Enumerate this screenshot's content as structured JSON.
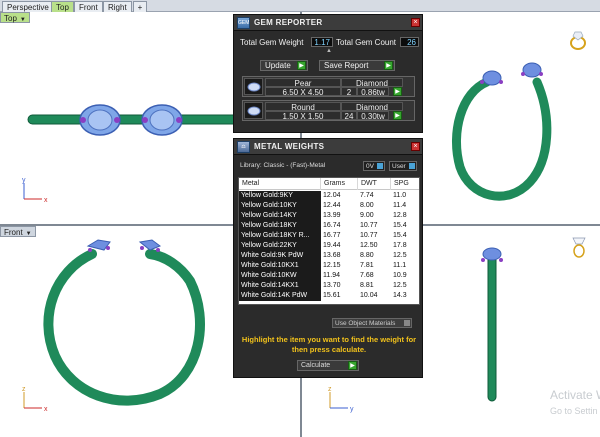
{
  "tabs": [
    "Perspective",
    "Top",
    "Front",
    "Right"
  ],
  "viewports": {
    "top_label": "Top",
    "front_label": "Front"
  },
  "colors": {
    "ring": "#1f8a5a",
    "gem": "#6e8fe0",
    "amethyst": "#8a3fc2",
    "yellow_text": "#f2c21b",
    "tab_active": "#b9e08a"
  },
  "gem_reporter": {
    "title": "GEM REPORTER",
    "total_gem_weight_label": "Total Gem Weight",
    "total_gem_weight": "1.17",
    "total_gem_count_label": "Total Gem Count",
    "total_gem_count": "26",
    "update_label": "Update",
    "save_report_label": "Save Report",
    "rows": [
      {
        "shape": "Pear",
        "size": "6.50 X 4.50",
        "count": "2",
        "type": "Diamond",
        "weight": "0.86tw"
      },
      {
        "shape": "Round",
        "size": "1.50 X 1.50",
        "count": "24",
        "type": "Diamond",
        "weight": "0.30tw"
      }
    ]
  },
  "metal_weights": {
    "title": "METAL WEIGHTS",
    "library": "Library: Classic - (Fast)-Metal",
    "sel_a": "0V",
    "sel_b": "User",
    "headers": [
      "Metal",
      "Grams",
      "DWT",
      "SPG"
    ],
    "rows": [
      {
        "metal": "Yellow Gold:9KY",
        "grams": "12.04",
        "dwt": "7.74",
        "spg": "11.0"
      },
      {
        "metal": "Yellow Gold:10KY",
        "grams": "12.44",
        "dwt": "8.00",
        "spg": "11.4"
      },
      {
        "metal": "Yellow Gold:14KY",
        "grams": "13.99",
        "dwt": "9.00",
        "spg": "12.8"
      },
      {
        "metal": "Yellow Gold:18KY",
        "grams": "16.74",
        "dwt": "10.77",
        "spg": "15.4"
      },
      {
        "metal": "Yellow Gold:18KY R...",
        "grams": "16.77",
        "dwt": "10.77",
        "spg": "15.4"
      },
      {
        "metal": "Yellow Gold:22KY",
        "grams": "19.44",
        "dwt": "12.50",
        "spg": "17.8"
      },
      {
        "metal": "White Gold:9K PdW",
        "grams": "13.68",
        "dwt": "8.80",
        "spg": "12.5"
      },
      {
        "metal": "White Gold:10KX1",
        "grams": "12.15",
        "dwt": "7.81",
        "spg": "11.1"
      },
      {
        "metal": "White Gold:10KW",
        "grams": "11.94",
        "dwt": "7.68",
        "spg": "10.9"
      },
      {
        "metal": "White Gold:14KX1",
        "grams": "13.70",
        "dwt": "8.81",
        "spg": "12.5"
      },
      {
        "metal": "White Gold:14K PdW",
        "grams": "15.61",
        "dwt": "10.04",
        "spg": "14.3"
      }
    ],
    "use_object_materials": "Use Object Materials",
    "highlight_msg": "Highlight the item you want to find the weight for then press calculate.",
    "calculate_label": "Calculate"
  },
  "axes": {
    "x": "x",
    "y": "y",
    "z": "z"
  },
  "watermark": {
    "line1": "Activate Wi",
    "line2": "Go to Settin"
  }
}
